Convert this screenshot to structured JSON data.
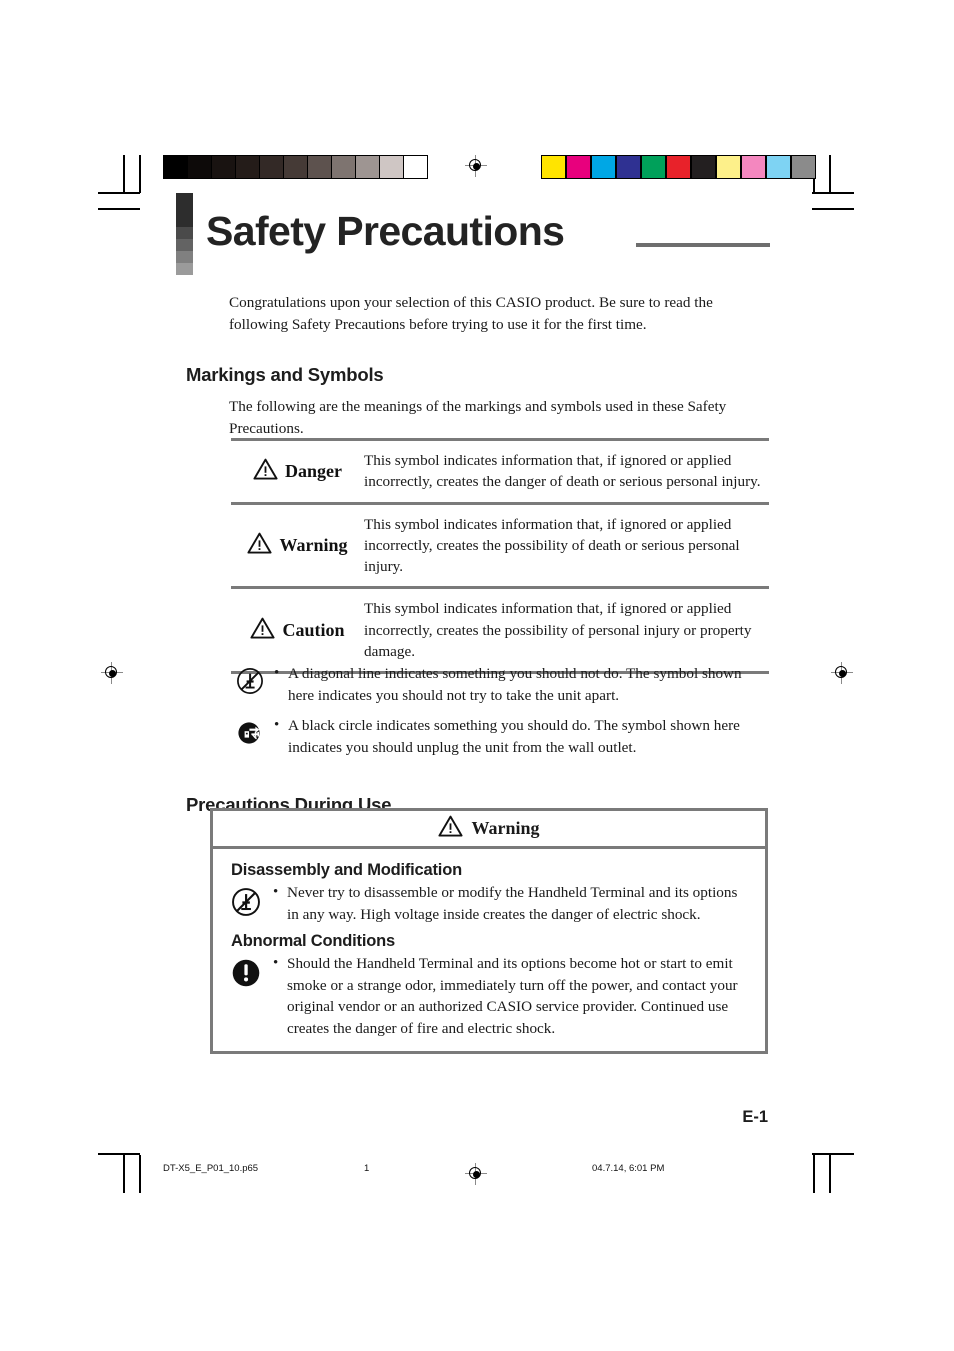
{
  "document": {
    "title": "Safety Precautions",
    "page_label": "E-1"
  },
  "intro": {
    "text": "Congratulations upon your selection of this CASIO product. Be sure to read the following Safety Precautions before trying to use it for the first time."
  },
  "markings_section": {
    "heading": "Markings and Symbols",
    "intro": "The following are the meanings of the markings and symbols used in these Safety Precautions.",
    "rows": [
      {
        "icon": "warning-triangle-icon",
        "label": "Danger",
        "description": "This symbol indicates information that, if ignored or applied incorrectly, creates the danger of death or serious personal injury."
      },
      {
        "icon": "warning-triangle-icon",
        "label": "Warning",
        "description": "This symbol indicates information that, if ignored or applied incorrectly, creates the possibility of death or serious personal injury."
      },
      {
        "icon": "warning-triangle-icon",
        "label": "Caution",
        "description": "This symbol indicates information that, if ignored or applied incorrectly, creates the possibility of personal injury or property damage."
      }
    ],
    "bullets": [
      {
        "icon": "no-disassembly-icon",
        "bullet": "•",
        "text": "A diagonal line indicates something you should not do. The symbol shown here indicates you should not try to take the unit apart."
      },
      {
        "icon": "unplug-icon",
        "bullet": "•",
        "text": "A black circle indicates something you should do. The symbol shown here indicates you should unplug the unit from the wall outlet."
      }
    ]
  },
  "precautions_section": {
    "heading": "Precautions During Use",
    "box": {
      "header_icon": "warning-triangle-icon",
      "header_label": "Warning",
      "groups": [
        {
          "title": "Disassembly and Modification",
          "icon": "no-disassembly-icon",
          "bullet": "•",
          "text": "Never try to disassemble or modify the Handheld Terminal and its options in any way. High voltage inside creates the danger of electric shock."
        },
        {
          "title": "Abnormal Conditions",
          "icon": "exclamation-circle-icon",
          "bullet": "•",
          "text": "Should the Handheld Terminal and its options become hot or start to emit smoke or a strange odor, immediately turn off the power, and contact your original vendor or an authorized CASIO service provider. Continued use creates the danger of fire and electric shock."
        }
      ]
    }
  },
  "footer": {
    "file_name": "DT-X5_E_P01_10.p65",
    "sheet_number": "1",
    "timestamp": "04.7.14, 6:01 PM"
  },
  "calibration": {
    "grayscale": [
      "#000000",
      "#0d0a09",
      "#191311",
      "#241c19",
      "#332926",
      "#453a36",
      "#5d524e",
      "#7e7470",
      "#9e9592",
      "#cfc6c4",
      "#ffffff"
    ],
    "color": [
      "#ffe400",
      "#e8007d",
      "#00a7e5",
      "#2f3192",
      "#00a05a",
      "#e8222a",
      "#231f20",
      "#fdf08a",
      "#f487bf",
      "#7ed3f3",
      "#8b8b8b"
    ]
  },
  "title_bar_segments": [
    "#2d2d2d",
    "#4a4a4a",
    "#636363",
    "#808080",
    "#9b9b9b"
  ],
  "accent_colors": {
    "rule_gray": "#7a7a7a",
    "title_ink": "#232323"
  }
}
